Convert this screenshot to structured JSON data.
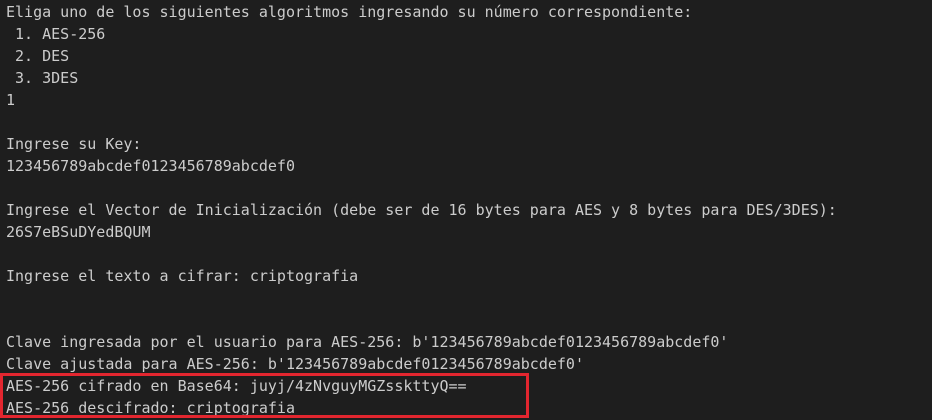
{
  "terminal": {
    "lines": [
      "Eliga uno de los siguientes algoritmos ingresando su número correspondiente:",
      " 1. AES-256",
      " 2. DES",
      " 3. 3DES",
      "1",
      "",
      "Ingrese su Key:",
      "123456789abcdef0123456789abcdef0",
      "",
      "Ingrese el Vector de Inicialización (debe ser de 16 bytes para AES y 8 bytes para DES/3DES):",
      "26S7eBSuDYedBQUM",
      "",
      "Ingrese el texto a cifrar: criptografia",
      "",
      "",
      "Clave ingresada por el usuario para AES-256: b'123456789abcdef0123456789abcdef0'",
      "Clave ajustada para AES-256: b'123456789abcdef0123456789abcdef0'",
      "AES-256 cifrado en Base64: juyj/4zNvguyMGZsskttyQ==",
      "AES-256 descifrado: criptografia"
    ]
  },
  "colors": {
    "background": "#1e1e1e",
    "text": "#cccccc",
    "highlight_border": "#e3262f"
  }
}
